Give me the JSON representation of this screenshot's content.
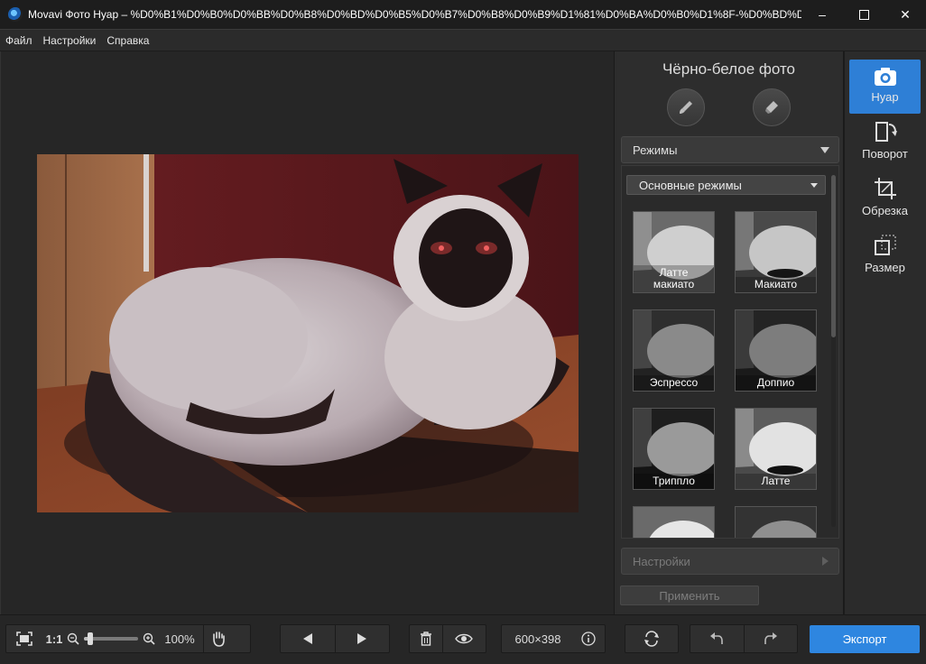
{
  "window": {
    "title": "Movavi Фото Нуар – %D0%B1%D0%B0%D0%BB%D0%B8%D0%BD%D0%B5%D0%B7%D0%B8%D0%B9%D1%81%D0%BA%D0%B0%D1%8F-%D0%BD%D0%B0-%",
    "minimize": "–",
    "maximize": "☐",
    "close": "✕"
  },
  "menu": [
    "Файл",
    "Настройки",
    "Справка"
  ],
  "panel": {
    "title": "Чёрно-белое фото",
    "modes_header": "Режимы",
    "modes_dropdown": "Основные режимы",
    "presets": [
      {
        "label": "Латте\nмакиато"
      },
      {
        "label": "Макиато"
      },
      {
        "label": "Эспрессо"
      },
      {
        "label": "Доппио"
      },
      {
        "label": "Триппло"
      },
      {
        "label": "Латте"
      },
      {
        "label": ""
      },
      {
        "label": ""
      }
    ],
    "settings_header": "Настройки",
    "apply": "Применить"
  },
  "right_tools": [
    {
      "label": "Нуар",
      "icon": "camera-icon",
      "active": true
    },
    {
      "label": "Поворот",
      "icon": "rotate-icon",
      "active": false
    },
    {
      "label": "Обрезка",
      "icon": "crop-icon",
      "active": false
    },
    {
      "label": "Размер",
      "icon": "resize-icon",
      "active": false
    }
  ],
  "bottom": {
    "actual_size": "1:1",
    "zoom": "100%",
    "zoom_level": 0.12,
    "dimensions": "600×398",
    "export": "Экспорт"
  },
  "colors": {
    "accent": "#2e86e0",
    "active_tool": "#2e7fd6",
    "panel_bg": "#2d2d2d"
  }
}
